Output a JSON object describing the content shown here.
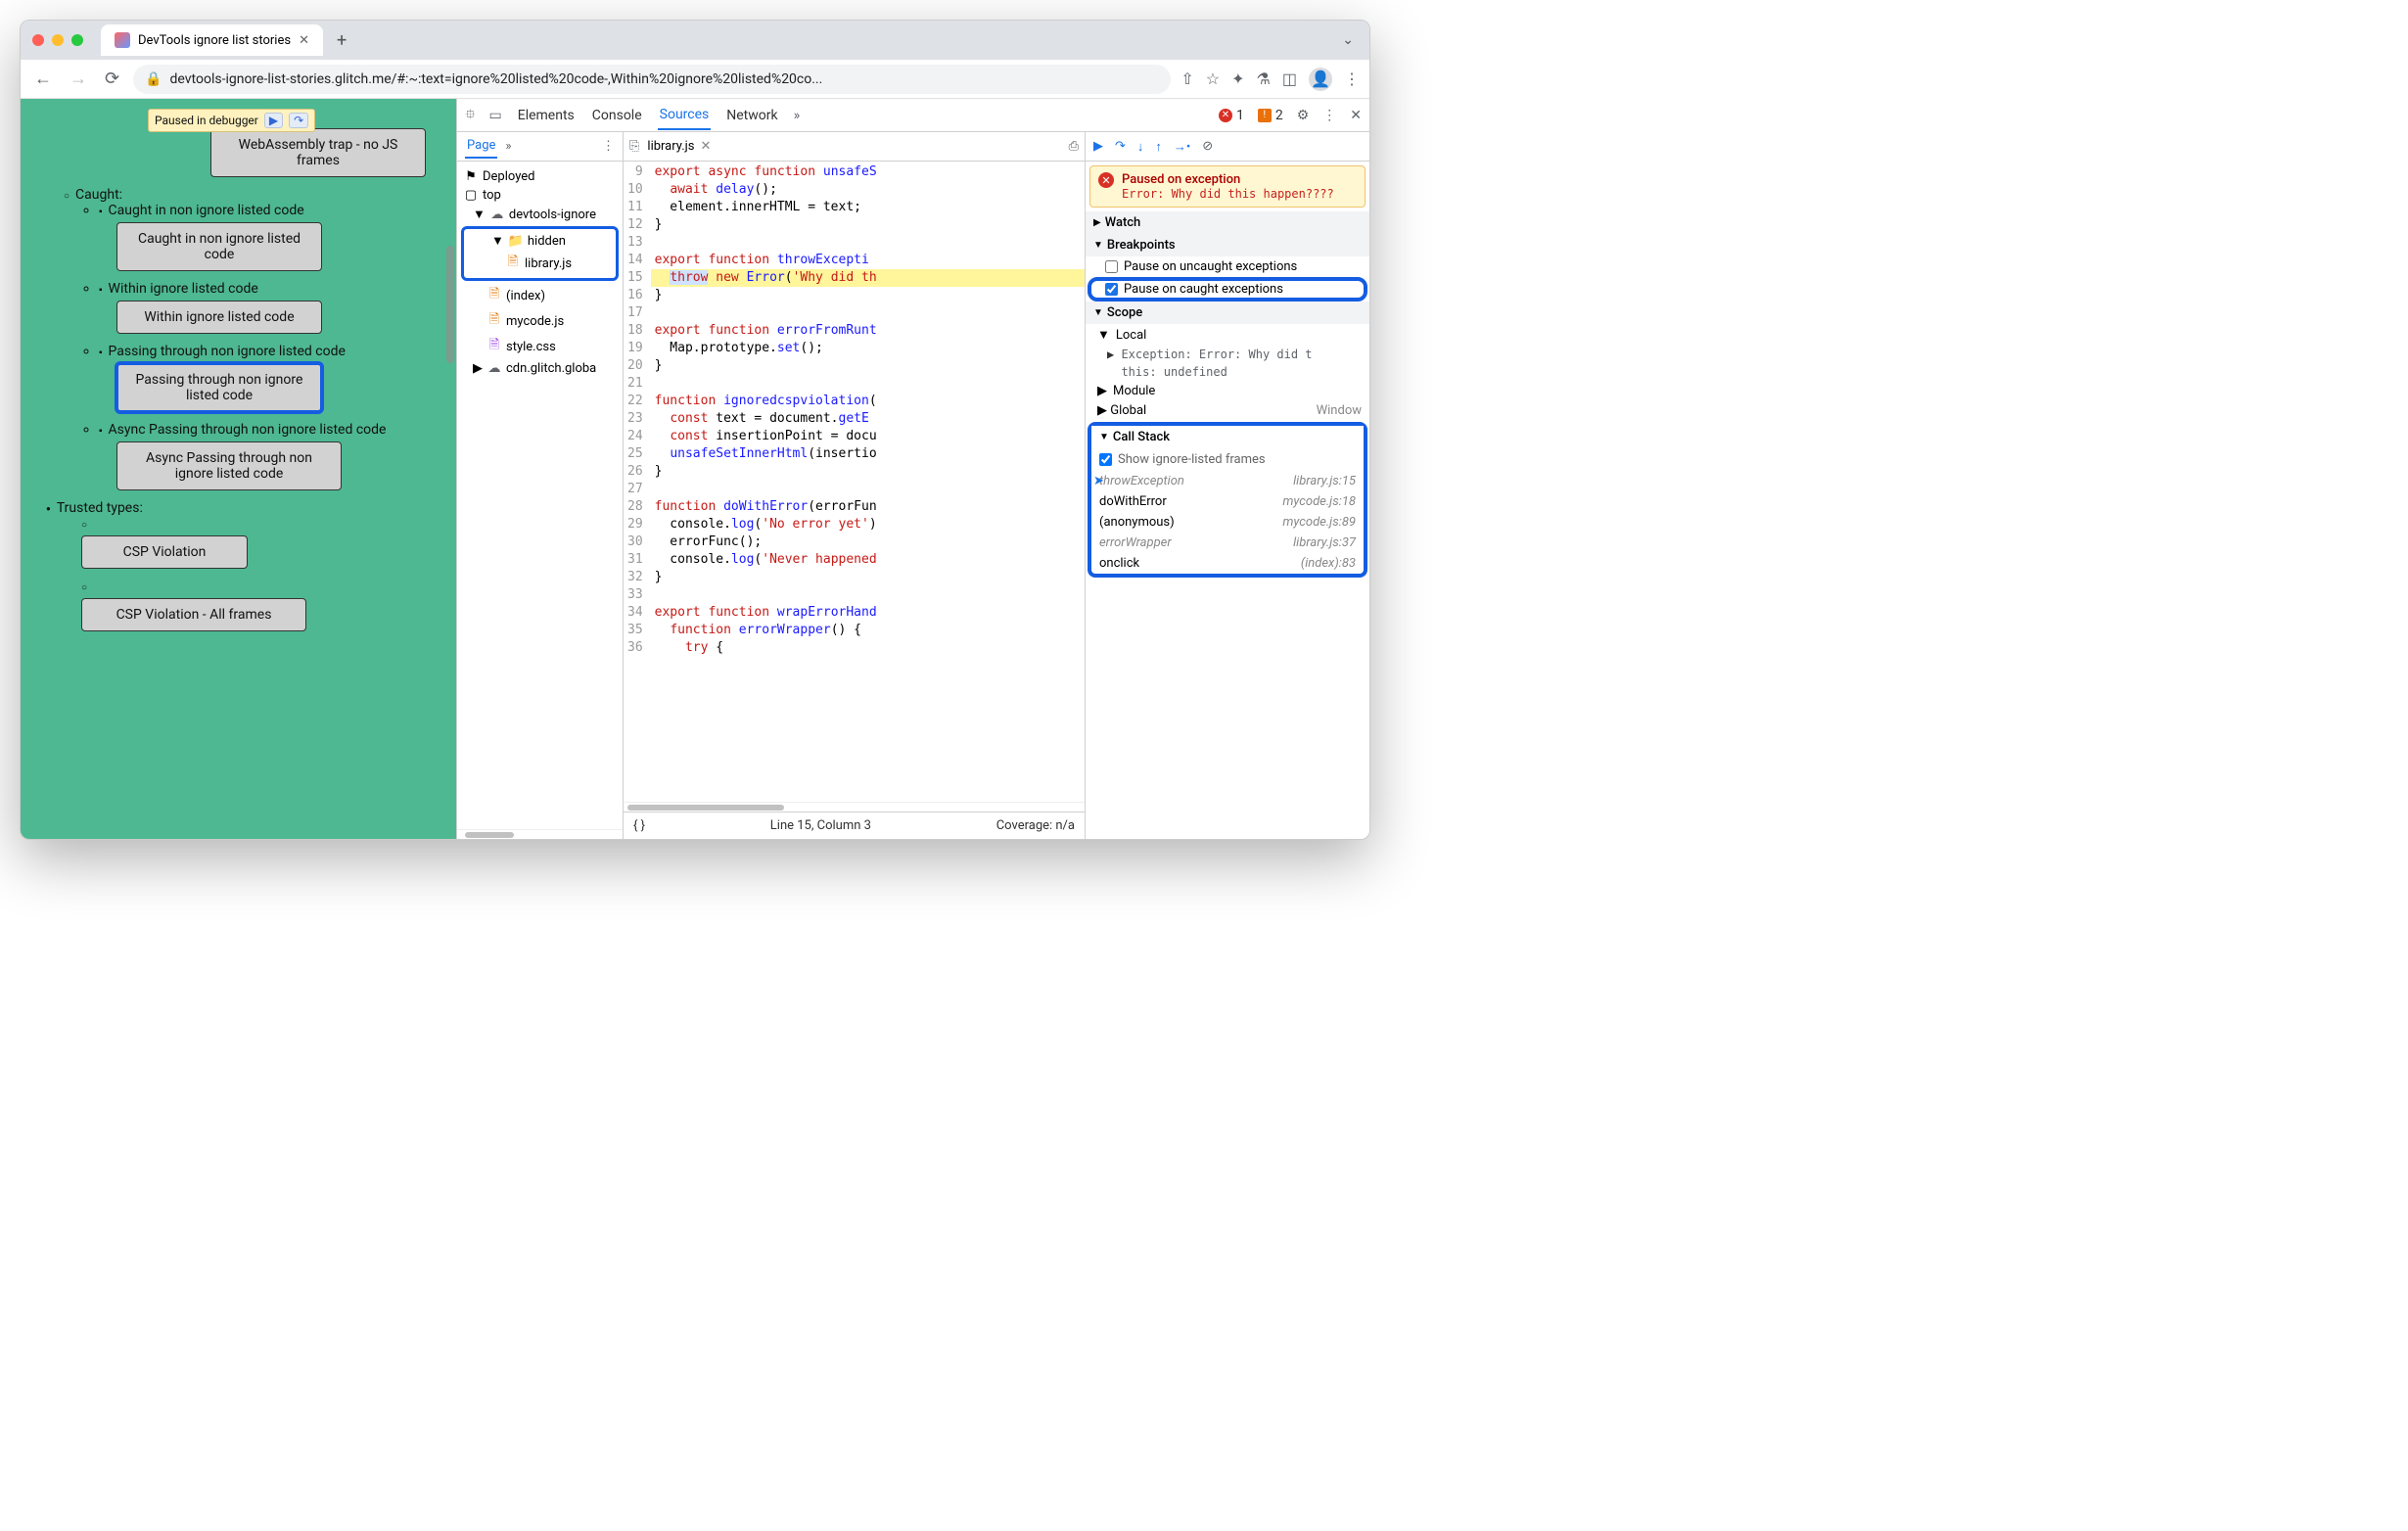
{
  "tab": {
    "title": "DevTools ignore list stories"
  },
  "url": "devtools-ignore-list-stories.glitch.me/#:~:text=ignore%20listed%20code-,Within%20ignore%20listed%20co...",
  "pauseChip": {
    "label": "Paused in debugger"
  },
  "errors": {
    "count": "1"
  },
  "issues": {
    "count": "2"
  },
  "page_content": {
    "b1": "WebAssembly trap - no JS frames",
    "caught": "Caught:",
    "c1": "Caught in non ignore listed code",
    "c1b": "Caught in non ignore listed code",
    "c2": "Within ignore listed code",
    "c2b": "Within ignore listed code",
    "c3": "Passing through non ignore listed code",
    "c3b": "Passing through non ignore listed code",
    "c4": "Async Passing through non ignore listed code",
    "c4b": "Async Passing through non ignore listed code",
    "tt": "Trusted types:",
    "t1": "CSP Violation",
    "t2": "CSP Violation - All frames"
  },
  "devtools_tabs": {
    "elements": "Elements",
    "console": "Console",
    "sources": "Sources",
    "network": "Network"
  },
  "navigator": {
    "tab": "Page",
    "deployed": "Deployed",
    "top": "top",
    "origin": "devtools-ignore",
    "hidden": "hidden",
    "library": "library.js",
    "index": "(index)",
    "mycode": "mycode.js",
    "style": "style.css",
    "cdn": "cdn.glitch.globa"
  },
  "editor": {
    "filename": "library.js",
    "lines": [
      "export async function unsafeS",
      "  await delay();",
      "  element.innerHTML = text;",
      "}",
      "",
      "export function throwExcepti",
      "  throw new Error('Why did th",
      "}",
      "",
      "export function errorFromRunt",
      "  Map.prototype.set();",
      "}",
      "",
      "function ignoredcspviolation(",
      "  const text = document.getE",
      "  const insertionPoint = docu",
      "  unsafeSetInnerHtml(insertio",
      "}",
      "",
      "function doWithError(errorFun",
      "  console.log('No error yet')",
      "  errorFunc();",
      "  console.log('Never happened",
      "}",
      "",
      "export function wrapErrorHand",
      "  function errorWrapper() {",
      "    try {"
    ],
    "first_line_no": 9,
    "status_line": "Line 15, Column 3",
    "status_cov": "Coverage: n/a"
  },
  "debugger": {
    "paused_title": "Paused on exception",
    "paused_error": "Error: Why did this happen????",
    "watch": "Watch",
    "breakpoints": "Breakpoints",
    "bp_uncaught": "Pause on uncaught exceptions",
    "bp_caught": "Pause on caught exceptions",
    "scope": "Scope",
    "local": "Local",
    "exc": "Exception: Error: Why did t",
    "this": "this: undefined",
    "module": "Module",
    "global": "Global",
    "global_val": "Window",
    "callstack": "Call Stack",
    "show_ignored": "Show ignore-listed frames",
    "frames": [
      {
        "fn": "throwException",
        "loc": "library.js:15",
        "ignored": true,
        "current": true
      },
      {
        "fn": "doWithError",
        "loc": "mycode.js:18",
        "ignored": false
      },
      {
        "fn": "(anonymous)",
        "loc": "mycode.js:89",
        "ignored": false
      },
      {
        "fn": "errorWrapper",
        "loc": "library.js:37",
        "ignored": true
      },
      {
        "fn": "onclick",
        "loc": "(index):83",
        "ignored": false
      }
    ]
  }
}
